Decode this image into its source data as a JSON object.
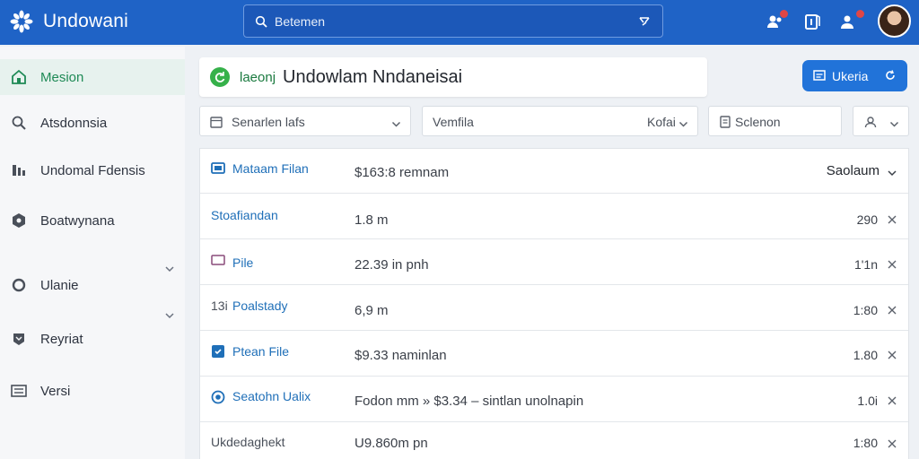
{
  "app": {
    "title": "Undowani",
    "colors": {
      "topbar": "#1f63c6",
      "accent": "#2173d9",
      "active_green": "#1f8a56",
      "link_blue": "#1f6fb8"
    }
  },
  "search": {
    "placeholder": "Betemen"
  },
  "topbar_icons": [
    "people-icon",
    "document-icon",
    "user-add-icon"
  ],
  "sidebar": {
    "items": [
      {
        "label": "Mesion",
        "icon": "home-icon",
        "active": true
      },
      {
        "label": "Atsdonnsia",
        "icon": "search-icon"
      },
      {
        "label": "Undomal Fdensis",
        "icon": "chart-icon"
      },
      {
        "label": "Boatwynana",
        "icon": "settings-icon"
      },
      {
        "label": "Ulanie",
        "icon": "circle-icon"
      },
      {
        "label": "Reyriat",
        "icon": "shield-icon"
      },
      {
        "label": "Versi",
        "icon": "list-icon"
      }
    ]
  },
  "header": {
    "prefix": "laeonj",
    "title": "Undowlam Nndaneisai"
  },
  "primary_button": {
    "label": "Ukeria"
  },
  "filters": {
    "filter1": {
      "label": "Senarlen lafs"
    },
    "filter2": {
      "label": "Vemfila",
      "label2": "Kofai"
    },
    "filter3": {
      "label": "Sclenon"
    }
  },
  "table": {
    "rows": [
      {
        "name": "Mataam Filan",
        "desc": "$163:8 remnam",
        "value": "Saolaum",
        "header": true,
        "icon": "screen-icon"
      },
      {
        "name": "Stoafiandan",
        "desc": "1.8 m",
        "value": "290",
        "icon": ""
      },
      {
        "name": "Pile",
        "desc": "22.39 in pnh",
        "value": "1'1n",
        "icon": "folder-icon"
      },
      {
        "name": "Poalstady",
        "prefix": "13i",
        "desc": "6,9 m",
        "value": "1:80",
        "icon": ""
      },
      {
        "name": "Ptean File",
        "desc": "$9.33 naminlan",
        "value": "1.80",
        "icon": "file-icon"
      },
      {
        "name": "Seatohn Ualix",
        "desc": "Fodon mm » $3.34 – sintlan unolnapin",
        "value": "1.0i",
        "icon": "target-icon"
      },
      {
        "name": "Ukdedaghekt",
        "desc": "U9.860m pn",
        "value": "1:80",
        "icon": ""
      }
    ]
  }
}
